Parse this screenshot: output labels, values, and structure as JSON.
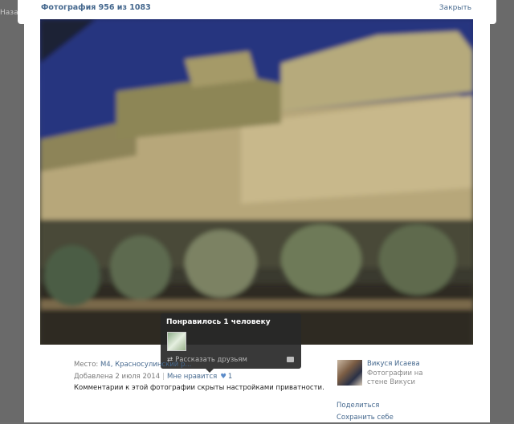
{
  "page": {
    "back_label": "Назад"
  },
  "header": {
    "title": "Фотография 956 из 1083",
    "close_label": "Закрыть"
  },
  "tooltip": {
    "title": "Понравилось 1 человеку",
    "share_label": "Рассказать друзьям"
  },
  "info": {
    "place_label": "Место:",
    "place_value": "М4, Красносулинский р...",
    "added_label": "Добавлена 2 июля 2014",
    "like_label": "Мне нравится",
    "like_count": "1",
    "privacy_text": "Комментарии к этой фотографии скрыты настройками приватности."
  },
  "owner": {
    "name": "Викуся Исаева",
    "album": "Фотографии на стене Викуси"
  },
  "side_actions": {
    "share": "Поделиться",
    "save": "Сохранить себе"
  },
  "colors": {
    "link": "#45688e",
    "overlay": "#6a6a6a",
    "tooltip_bg": "#282828"
  }
}
